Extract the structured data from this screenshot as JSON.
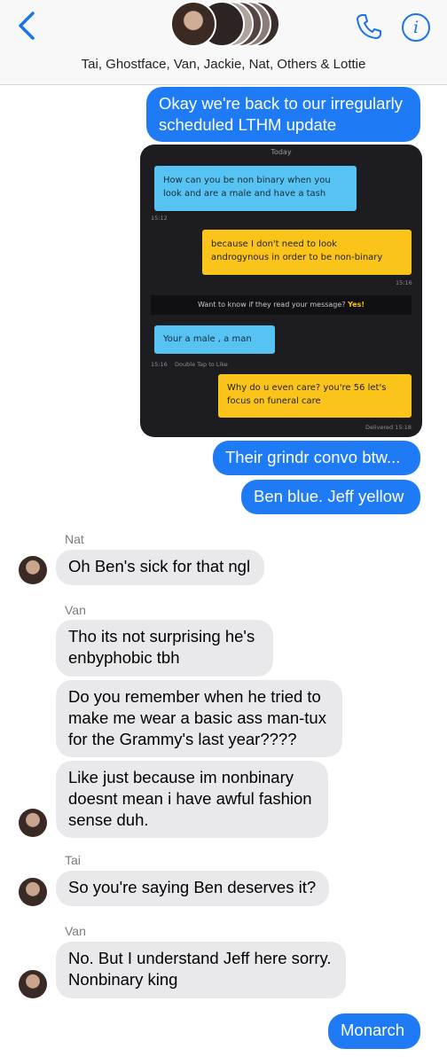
{
  "header": {
    "back_icon": "chevron-left-icon",
    "group_title": "Tai, Ghostface, Van, Jackie, Nat, Others & Lottie",
    "phone_icon": "phone-icon",
    "info_icon_glyph": "i",
    "accent_color": "#1a73e8"
  },
  "messages": {
    "m1": {
      "line1": "Okay we're back to our irregularly",
      "line2": "scheduled LTHM update"
    },
    "m2": "Their grindr convo btw...",
    "m3": "Ben blue. Jeff yellow",
    "sender_nat": "Nat",
    "m4": "Oh Ben's sick for that ngl",
    "sender_van1": "Van",
    "m5": {
      "line1": "Tho its not surprising he's",
      "line2": "enbyphobic tbh"
    },
    "m6": {
      "line1": "Do you remember when he tried to",
      "line2": "make me wear a basic ass man-tux",
      "line3": "for the Grammy's last year????"
    },
    "m7": {
      "line1": "Like just because im nonbinary",
      "line2": "doesnt mean i have awful fashion",
      "line3": "sense duh."
    },
    "sender_tai": "Tai",
    "m8": "So you're saying Ben deserves it?",
    "sender_van2": "Van",
    "m9": {
      "line1": "No. But I understand Jeff here sorry.",
      "line2": "Nonbinary king"
    },
    "m10": "Monarch"
  },
  "screenshot": {
    "day_label": "Today",
    "blue1": {
      "line1": "How can you be non binary when you",
      "line2": "look and are a male and have a tash"
    },
    "time1": "15:12",
    "yellow1": {
      "line1": "because I don't need to look",
      "line2": "androgynous in order to be non-binary"
    },
    "time2": "15:16",
    "read_prompt": "Want to know if they read your message?",
    "read_prompt_cta": "Yes!",
    "blue2": "Your a male , a man",
    "time3": "15:16",
    "double_tap": "Double Tap to Like",
    "yellow2": {
      "line1": "Why do u even care? you're 56 let's",
      "line2": "focus on funeral care"
    },
    "delivered": "Delivered 15:18"
  },
  "colors": {
    "outgoing_bubble": "#1f7bf5",
    "incoming_bubble": "#e9e9eb",
    "grindr_blue": "#56c3f2",
    "grindr_yellow": "#fac41a"
  }
}
